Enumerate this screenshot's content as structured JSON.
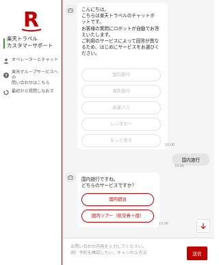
{
  "brand": {
    "name_line1": "楽天トラベル",
    "name_line2": "カスタマーサポート",
    "accent": "#bf0000"
  },
  "sidebar": {
    "items": [
      {
        "icon": "person-icon",
        "label": "オペレーターとチャット"
      },
      {
        "icon": "question-icon",
        "label": "楽天グループサービスへの\n問い合わせはこちら"
      },
      {
        "icon": "restart-icon",
        "label": "最初から質問しなおす"
      }
    ]
  },
  "chat": {
    "bot_greeting": "こんにちは。\nこちらは楽天トラベルのチャットボ\nットです。\nお客様の質問にロボットが自動でお答\nえいたします。\nご利用のサービスによって回答が異な\nるため、はじめにサービスをお選びく\nださい。",
    "options": [
      "国内旅行",
      "海外旅行",
      "高速バス",
      "レンタカー",
      "もっと見る"
    ],
    "time1": "10:06",
    "user_message": "国内旅行",
    "time2": "10:06",
    "bot_reply": "国内旅行ですね。\nどちらのサービスですか？",
    "sub_options": [
      "国内宿泊",
      "国内ツアー（航空券＋宿）"
    ],
    "time3": "10:06"
  },
  "composer": {
    "placeholder": "お問い合わせ内容を入力してください。\n例）予約を確認したい、キャンセル方法",
    "send_label": "送信"
  }
}
